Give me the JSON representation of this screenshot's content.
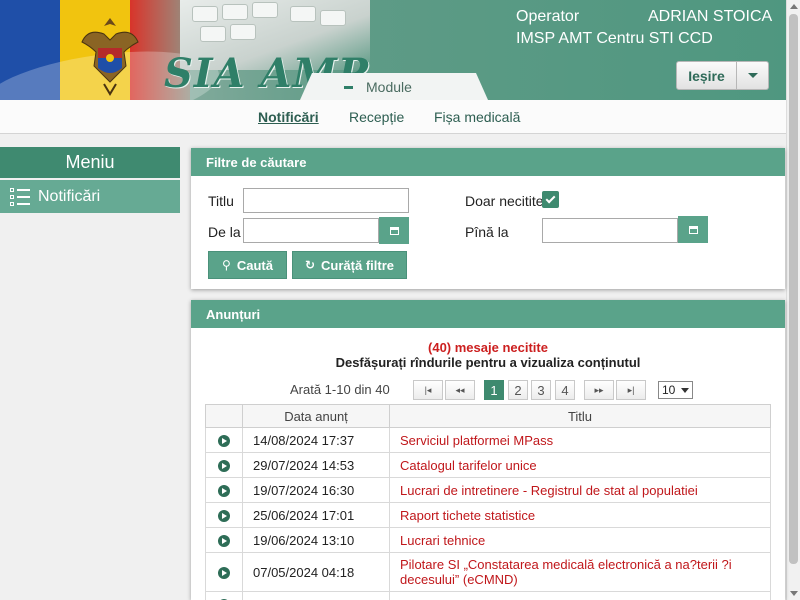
{
  "header": {
    "app_title": "SIA AMP",
    "operator_label": "Operator",
    "operator_name": "ADRIAN STOICA",
    "institution": "IMSP AMT Centru STI CCD",
    "logout_label": "Ieșire",
    "module_tab": "Module"
  },
  "nav": {
    "items": [
      {
        "label": "Notificări",
        "active": true
      },
      {
        "label": "Recepție",
        "active": false
      },
      {
        "label": "Fișa medicală",
        "active": false
      }
    ]
  },
  "sidebar": {
    "title": "Meniu",
    "items": [
      {
        "label": "Notificări"
      }
    ]
  },
  "filters": {
    "title": "Filtre de căutare",
    "title_label": "Titlu",
    "title_value": "",
    "from_label": "De la",
    "from_value": "",
    "unread_label": "Doar necitite",
    "unread_checked": true,
    "to_label": "Pînă la",
    "to_value": "",
    "search_button": "Caută",
    "clear_button": "Curăță filtre"
  },
  "announcements": {
    "title": "Anunțuri",
    "unread_count": "(40) mesaje necitite",
    "hint": "Desfășurați rîndurile pentru a vizualiza conținutul",
    "pager": {
      "info": "Arată 1-10 din 40",
      "pages": [
        "1",
        "2",
        "3",
        "4"
      ],
      "current_page": "1",
      "page_size": "10"
    },
    "columns": [
      "Data anunț",
      "Titlu"
    ],
    "rows": [
      {
        "date": "14/08/2024 17:37",
        "title": "Serviciul platformei MPass"
      },
      {
        "date": "29/07/2024 14:53",
        "title": "Catalogul tarifelor unice"
      },
      {
        "date": "19/07/2024 16:30",
        "title": "Lucrari de intretinere - Registrul de stat al populatiei"
      },
      {
        "date": "25/06/2024 17:01",
        "title": "Raport tichete statistice"
      },
      {
        "date": "19/06/2024 13:10",
        "title": "Lucrari tehnice"
      },
      {
        "date": "07/05/2024 04:18",
        "title": "Pilotare SI „Constatarea medicală electronică a na?terii ?i decesului” (eCMND)"
      }
    ]
  },
  "colors": {
    "primary": "#5aa38a",
    "dark": "#3e8a6f",
    "link": "#c0171b"
  }
}
